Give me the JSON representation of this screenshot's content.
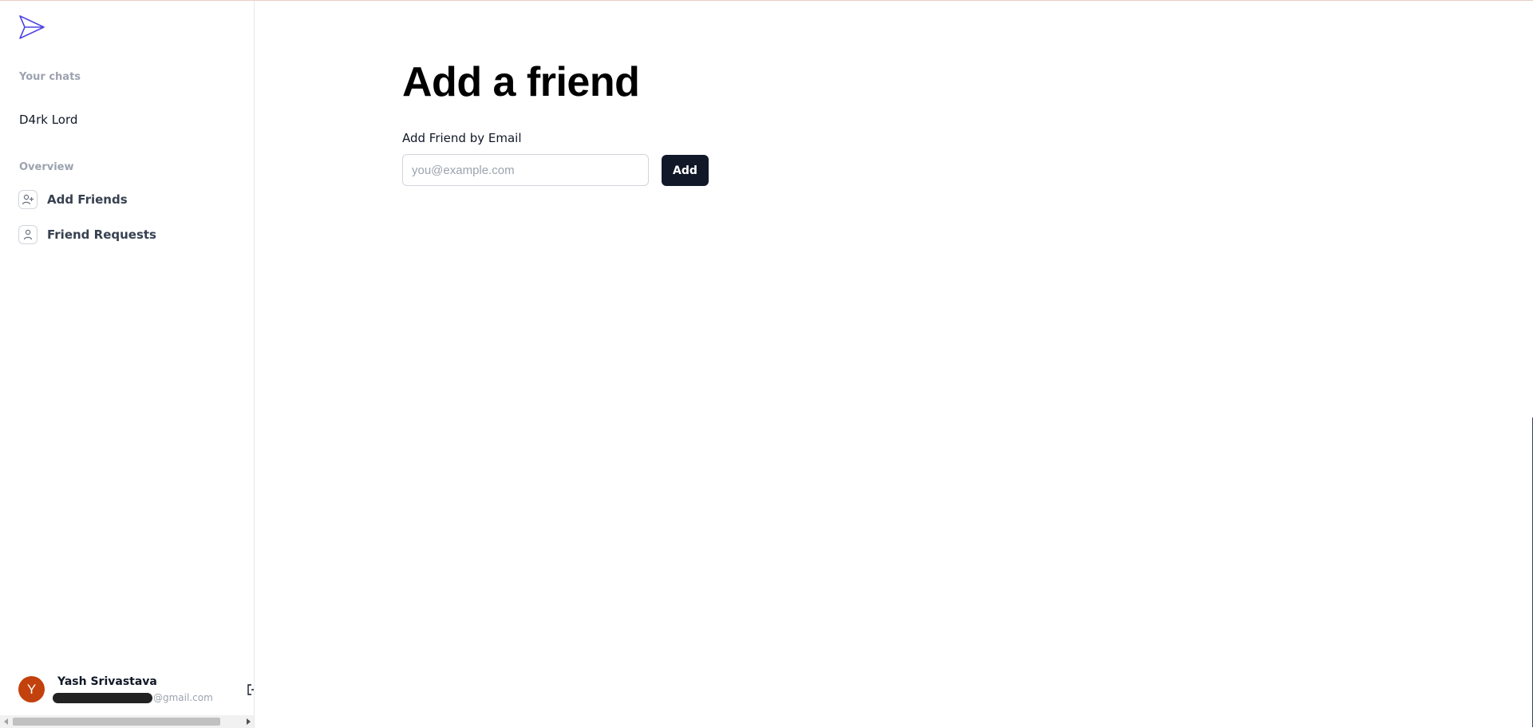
{
  "sidebar": {
    "logo_icon": "paper-plane-icon",
    "chats_heading": "Your chats",
    "chats": [
      {
        "name": "D4rk Lord"
      }
    ],
    "overview_heading": "Overview",
    "nav_items": [
      {
        "label": "Add Friends",
        "icon": "user-plus-icon"
      },
      {
        "label": "Friend Requests",
        "icon": "user-icon"
      }
    ],
    "user": {
      "initial": "Y",
      "name": "Yash Srivastava",
      "email_domain": "@gmail.com"
    },
    "logout_icon": "sign-out-icon"
  },
  "main": {
    "title": "Add a friend",
    "form": {
      "label": "Add Friend by Email",
      "placeholder": "you@example.com",
      "value": "",
      "button_label": "Add"
    }
  },
  "colors": {
    "accent": "#4f46e5",
    "button_bg": "#111827",
    "avatar_bg": "#c2410c",
    "muted_text": "#9ca3af"
  }
}
